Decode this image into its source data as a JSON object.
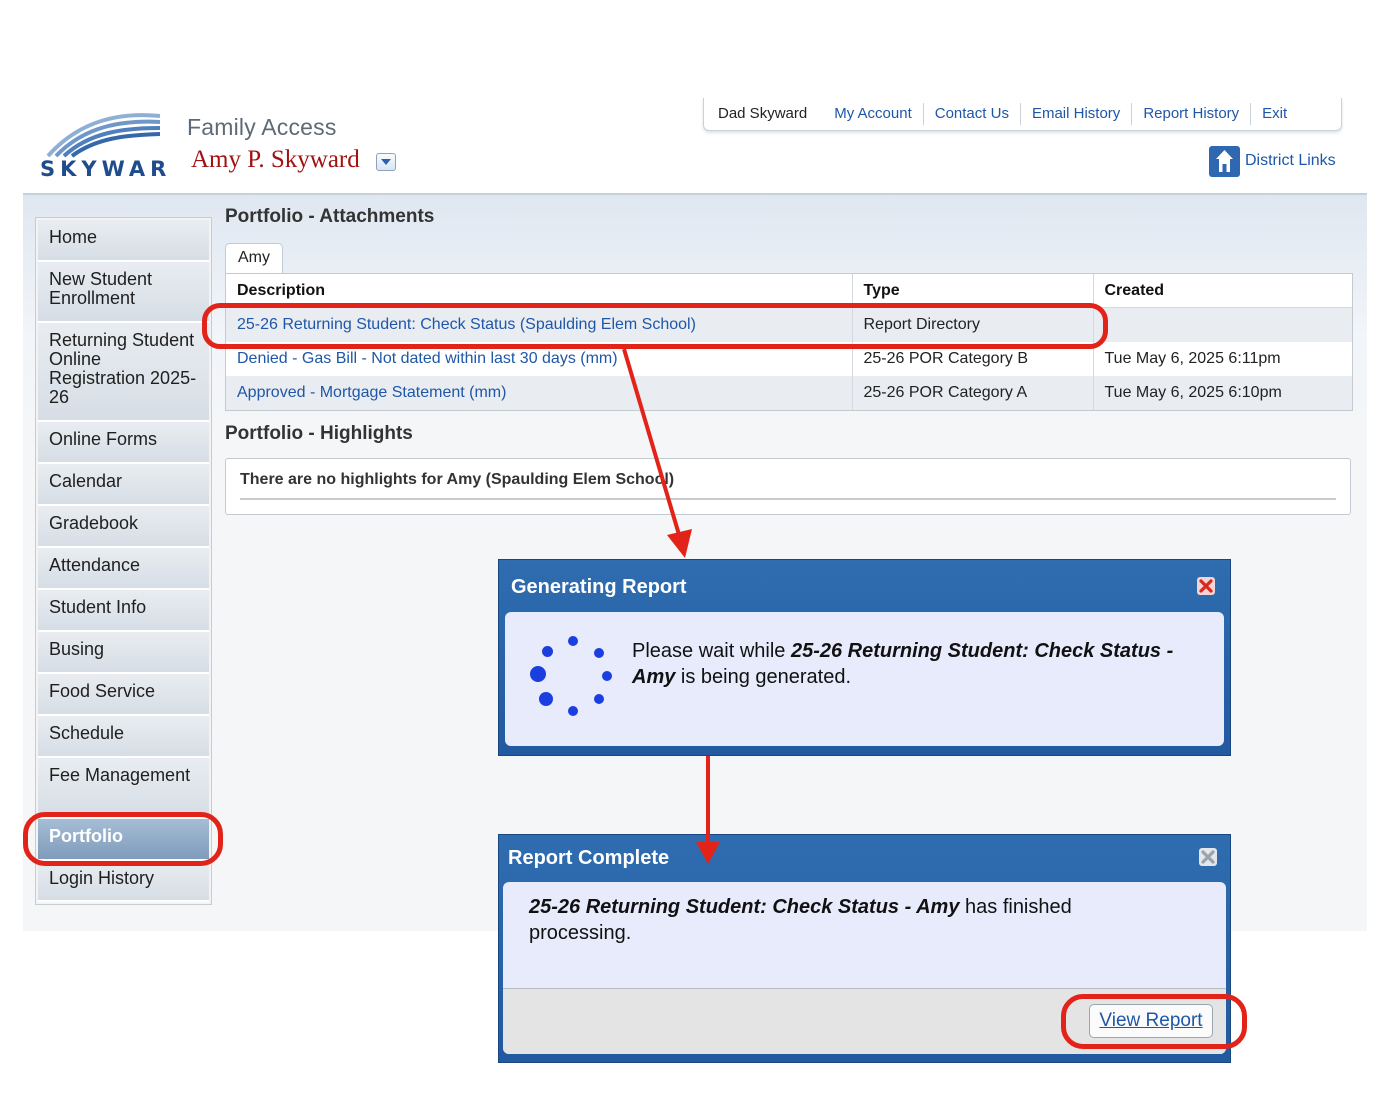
{
  "header": {
    "logo_text": "SKYWARD",
    "app_title": "Family Access",
    "student_name": "Amy P. Skyward",
    "district_links": "District Links"
  },
  "topnav": {
    "user": "Dad Skyward",
    "links": [
      "My Account",
      "Contact Us",
      "Email History",
      "Report History",
      "Exit"
    ]
  },
  "sidebar": {
    "items": [
      {
        "label": "Home"
      },
      {
        "label": "New Student Enrollment"
      },
      {
        "label": "Returning Student Online Registration 2025-26"
      },
      {
        "label": "Online Forms"
      },
      {
        "label": "Calendar"
      },
      {
        "label": "Gradebook"
      },
      {
        "label": "Attendance"
      },
      {
        "label": "Student Info"
      },
      {
        "label": "Busing"
      },
      {
        "label": "Food Service"
      },
      {
        "label": "Schedule"
      },
      {
        "label": "Fee Management"
      },
      {
        "label": "Portfolio",
        "active": true
      },
      {
        "label": "Login History"
      }
    ]
  },
  "attachments": {
    "title": "Portfolio - Attachments",
    "tab": "Amy",
    "columns": [
      "Description",
      "Type",
      "Created"
    ],
    "rows": [
      {
        "description": "25-26 Returning Student: Check Status (Spaulding Elem School)",
        "type": "Report Directory",
        "created": ""
      },
      {
        "description": "Denied - Gas Bill - Not dated within last 30 days (mm)",
        "type": "25-26 POR Category B",
        "created": "Tue May 6, 2025 6:11pm"
      },
      {
        "description": "Approved - Mortgage Statement (mm)",
        "type": "25-26 POR Category A",
        "created": "Tue May 6, 2025 6:10pm"
      }
    ]
  },
  "highlights": {
    "title": "Portfolio - Highlights",
    "empty_message": "There are no highlights for Amy (Spaulding Elem School)"
  },
  "generating_dialog": {
    "title": "Generating Report",
    "prefix": "Please wait while ",
    "report_name": "25-26 Returning Student: Check Status - Amy",
    "suffix": " is being generated."
  },
  "complete_dialog": {
    "title": "Report Complete",
    "report_name": "25-26 Returning Student: Check Status - Amy",
    "suffix": " has finished processing.",
    "button": "View Report"
  },
  "colors": {
    "link": "#1f57a8",
    "student_name": "#a11212",
    "dialog_header": "#2f6db0",
    "annotation": "#e2231a"
  }
}
